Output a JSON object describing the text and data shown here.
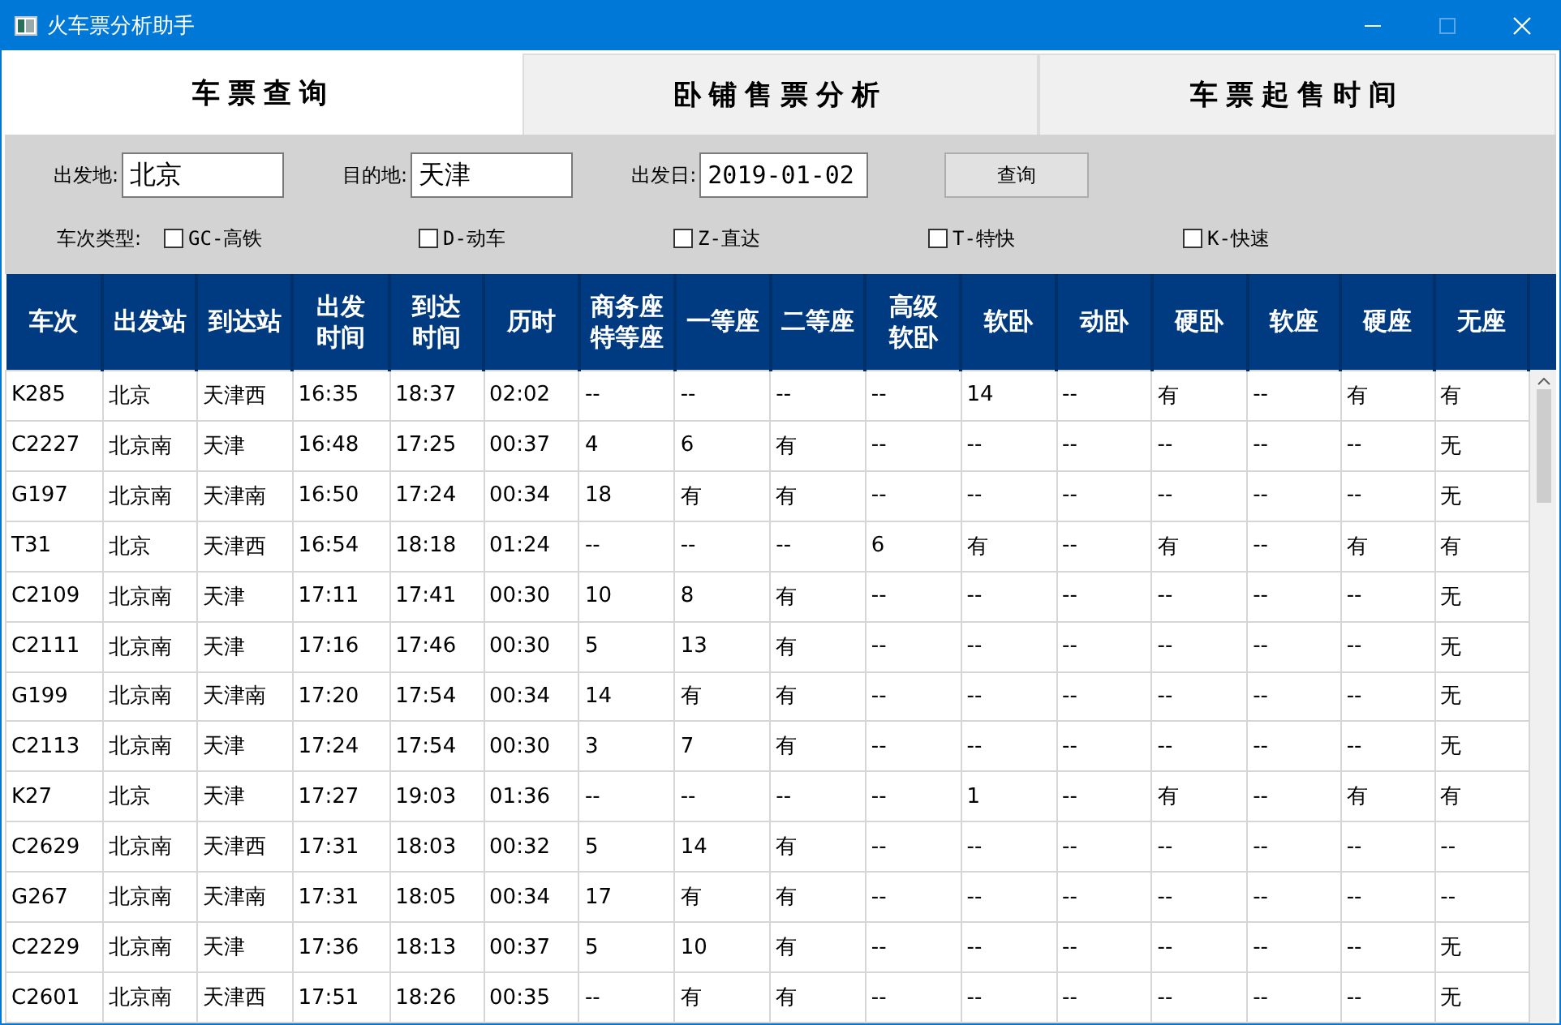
{
  "window": {
    "title": "火车票分析助手",
    "maximize_disabled": true
  },
  "tabs": [
    {
      "label": "车票查询",
      "selected": true
    },
    {
      "label": "卧铺售票分析",
      "selected": false
    },
    {
      "label": "车票起售时间",
      "selected": false
    }
  ],
  "form": {
    "fields": [
      {
        "label": "出发地:",
        "value": "北京"
      },
      {
        "label": "目的地:",
        "value": "天津"
      },
      {
        "label": "出发日:",
        "value": "2019-01-02"
      }
    ],
    "query_button": "查询",
    "type_label": "车次类型:",
    "types": [
      {
        "label": "GC-高铁",
        "checked": false
      },
      {
        "label": "D-动车",
        "checked": false
      },
      {
        "label": "Z-直达",
        "checked": false
      },
      {
        "label": "T-特快",
        "checked": false
      },
      {
        "label": "K-快速",
        "checked": false
      }
    ]
  },
  "table": {
    "columns": [
      "车次",
      "出发站",
      "到达站",
      "出发时间",
      "到达时间",
      "历时",
      "商务座特等座",
      "一等座",
      "二等座",
      "高级软卧",
      "软卧",
      "动卧",
      "硬卧",
      "软座",
      "硬座",
      "无座"
    ],
    "rows": [
      [
        "K285",
        "北京",
        "天津西",
        "16:35",
        "18:37",
        "02:02",
        "--",
        "--",
        "--",
        "--",
        "14",
        "--",
        "有",
        "--",
        "有",
        "有"
      ],
      [
        "C2227",
        "北京南",
        "天津",
        "16:48",
        "17:25",
        "00:37",
        "4",
        "6",
        "有",
        "--",
        "--",
        "--",
        "--",
        "--",
        "--",
        "无"
      ],
      [
        "G197",
        "北京南",
        "天津南",
        "16:50",
        "17:24",
        "00:34",
        "18",
        "有",
        "有",
        "--",
        "--",
        "--",
        "--",
        "--",
        "--",
        "无"
      ],
      [
        "T31",
        "北京",
        "天津西",
        "16:54",
        "18:18",
        "01:24",
        "--",
        "--",
        "--",
        "6",
        "有",
        "--",
        "有",
        "--",
        "有",
        "有"
      ],
      [
        "C2109",
        "北京南",
        "天津",
        "17:11",
        "17:41",
        "00:30",
        "10",
        "8",
        "有",
        "--",
        "--",
        "--",
        "--",
        "--",
        "--",
        "无"
      ],
      [
        "C2111",
        "北京南",
        "天津",
        "17:16",
        "17:46",
        "00:30",
        "5",
        "13",
        "有",
        "--",
        "--",
        "--",
        "--",
        "--",
        "--",
        "无"
      ],
      [
        "G199",
        "北京南",
        "天津南",
        "17:20",
        "17:54",
        "00:34",
        "14",
        "有",
        "有",
        "--",
        "--",
        "--",
        "--",
        "--",
        "--",
        "无"
      ],
      [
        "C2113",
        "北京南",
        "天津",
        "17:24",
        "17:54",
        "00:30",
        "3",
        "7",
        "有",
        "--",
        "--",
        "--",
        "--",
        "--",
        "--",
        "无"
      ],
      [
        "K27",
        "北京",
        "天津",
        "17:27",
        "19:03",
        "01:36",
        "--",
        "--",
        "--",
        "--",
        "1",
        "--",
        "有",
        "--",
        "有",
        "有"
      ],
      [
        "C2629",
        "北京南",
        "天津西",
        "17:31",
        "18:03",
        "00:32",
        "5",
        "14",
        "有",
        "--",
        "--",
        "--",
        "--",
        "--",
        "--",
        "--"
      ],
      [
        "G267",
        "北京南",
        "天津南",
        "17:31",
        "18:05",
        "00:34",
        "17",
        "有",
        "有",
        "--",
        "--",
        "--",
        "--",
        "--",
        "--",
        "--"
      ],
      [
        "C2229",
        "北京南",
        "天津",
        "17:36",
        "18:13",
        "00:37",
        "5",
        "10",
        "有",
        "--",
        "--",
        "--",
        "--",
        "--",
        "--",
        "无"
      ],
      [
        "C2601",
        "北京南",
        "天津西",
        "17:51",
        "18:26",
        "00:35",
        "--",
        "有",
        "有",
        "--",
        "--",
        "--",
        "--",
        "--",
        "--",
        "无"
      ]
    ]
  }
}
